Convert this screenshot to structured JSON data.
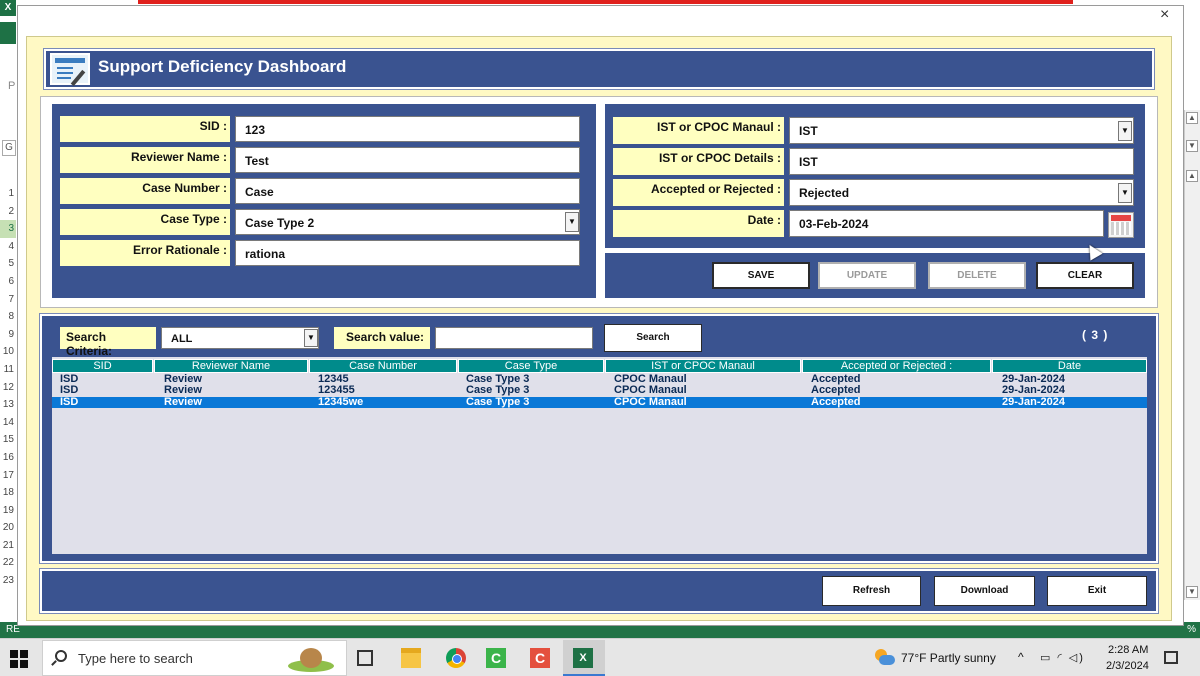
{
  "excel": {
    "logo": "X",
    "cell_p": "P",
    "cell_g": "G",
    "rows": [
      "1",
      "2",
      "3",
      "4",
      "5",
      "6",
      "7",
      "8",
      "9",
      "10",
      "11",
      "12",
      "13",
      "14",
      "15",
      "16",
      "17",
      "18",
      "19",
      "20",
      "21",
      "22",
      "23"
    ],
    "selected_row": "3",
    "status_left": "RE",
    "status_right": "%"
  },
  "window": {
    "close": "×"
  },
  "header": {
    "title": "Support Deficiency Dashboard"
  },
  "left_form": {
    "sid_label": "SID :",
    "sid_value": "123",
    "reviewer_label": "Reviewer Name :",
    "reviewer_value": "Test",
    "case_number_label": "Case Number :",
    "case_number_value": "Case",
    "case_type_label": "Case Type :",
    "case_type_value": "Case Type 2",
    "error_label": "Error Rationale :",
    "error_value": "rationa"
  },
  "right_form": {
    "ist_manual_label": "IST or CPOC Manaul :",
    "ist_manual_value": "IST",
    "ist_details_label": "IST or CPOC Details :",
    "ist_details_value": "IST",
    "accepted_label": "Accepted or Rejected :",
    "accepted_value": "Rejected",
    "date_label": "Date :",
    "date_value": "03-Feb-2024"
  },
  "actions": {
    "save": "SAVE",
    "update": "UPDATE",
    "delete": "DELETE",
    "clear": "CLEAR"
  },
  "search": {
    "criteria_label": "Search Criteria:",
    "criteria_value": "ALL",
    "value_label": "Search value:",
    "value": "",
    "button": "Search",
    "count": "( 3 )"
  },
  "table": {
    "headers": [
      "SID",
      "Reviewer Name",
      "Case Number",
      "Case Type",
      "IST or CPOC Manaul",
      "Accepted or Rejected :",
      "Date"
    ],
    "rows": [
      [
        "ISD",
        "Review",
        "12345",
        "Case Type 3",
        "CPOC Manaul",
        "Accepted",
        "29-Jan-2024"
      ],
      [
        "ISD",
        "Review",
        "123455",
        "Case Type 3",
        "CPOC Manaul",
        "Accepted",
        "29-Jan-2024"
      ],
      [
        "ISD",
        "Review",
        "12345we",
        "Case Type 3",
        "CPOC Manaul",
        "Accepted",
        "29-Jan-2024"
      ]
    ],
    "selected_row": 2
  },
  "footer": {
    "refresh": "Refresh",
    "download": "Download",
    "exit": "Exit"
  },
  "taskbar": {
    "search_placeholder": "Type here to search",
    "weather": "77°F  Partly sunny",
    "tray_chevron": "^",
    "tray_icons": "▭ ◜ ◁)",
    "time": "2:28 AM",
    "date": "2/3/2024",
    "green_app": "C",
    "red_app": "C",
    "excel_app": "X"
  },
  "colors": {
    "navy": "#3a5390",
    "cream": "#fff9c4",
    "label_yellow": "#ffffc0",
    "header_teal": "#008b8b",
    "selection_blue": "#0a78d7"
  }
}
